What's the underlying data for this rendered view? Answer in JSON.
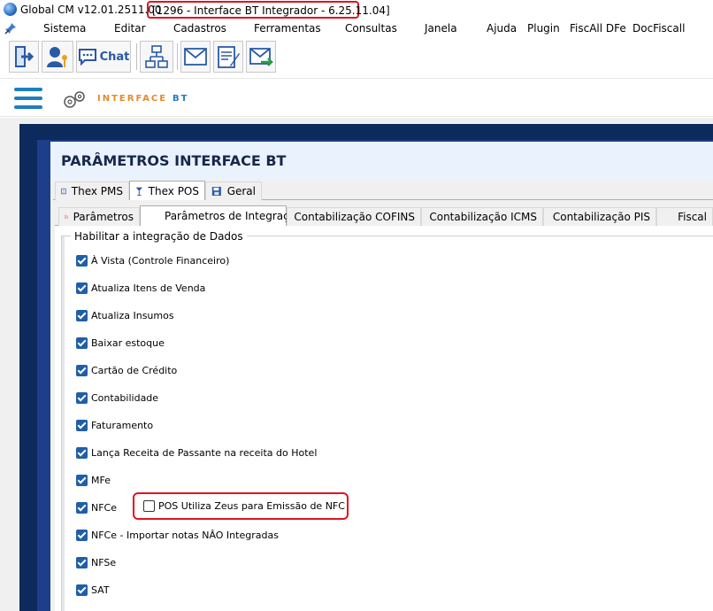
{
  "window": {
    "title": "Global CM v12.01.2511.00",
    "module_title": "[1296 - Interface BT Integrador - 6.25.11.04]"
  },
  "menu": {
    "items": [
      "Sistema",
      "Editar",
      "Cadastros",
      "Ferramentas",
      "Consultas",
      "Janela",
      "Ajuda",
      "Plugin",
      "FiscAll DFe",
      "DocFiscall"
    ]
  },
  "toolbar": {
    "chat_label": "Chat",
    "icons": [
      "exit-icon",
      "user-key-icon",
      "chat-icon",
      "org-chart-icon",
      "mail-icon",
      "document-pen-icon",
      "mail-forward-icon"
    ]
  },
  "header": {
    "brand_main": "INTERFACE",
    "brand_suffix": "BT"
  },
  "panel": {
    "title": "PARÂMETROS INTERFACE BT",
    "tabs": [
      {
        "label": "Thex PMS",
        "icon": "building-icon",
        "active": false
      },
      {
        "label": "Thex POS",
        "icon": "cocktail-icon",
        "active": true
      },
      {
        "label": "Geral",
        "icon": "save-icon",
        "active": false
      }
    ],
    "subtabs": [
      {
        "label": "Parâmetros",
        "active": false
      },
      {
        "label": "Parâmetros de Integração",
        "active": true
      },
      {
        "label": "Contabilização COFINS",
        "active": false
      },
      {
        "label": "Contabilização ICMS",
        "active": false
      },
      {
        "label": "Contabilização PIS",
        "active": false
      },
      {
        "label": "Fiscal",
        "active": false
      }
    ]
  },
  "group": {
    "legend": "Habilitar a integração de Dados",
    "options": [
      {
        "label": "À Vista (Controle Financeiro)",
        "checked": true
      },
      {
        "label": "Atualiza Itens de Venda",
        "checked": true
      },
      {
        "label": "Atualiza Insumos",
        "checked": true
      },
      {
        "label": "Baixar estoque",
        "checked": true
      },
      {
        "label": "Cartão de Crédito",
        "checked": true
      },
      {
        "label": "Contabilidade",
        "checked": true
      },
      {
        "label": "Faturamento",
        "checked": true
      },
      {
        "label": "Lança Receita de Passante na receita do Hotel",
        "checked": true
      },
      {
        "label": "MFe",
        "checked": true
      },
      {
        "label": "NFCe",
        "checked": true
      },
      {
        "label": "NFCe - Importar notas NÂO Integradas",
        "checked": true
      },
      {
        "label": "NFSe",
        "checked": true
      },
      {
        "label": "SAT",
        "checked": true
      }
    ],
    "nfce_suboption": {
      "label": "POS Utiliza Zeus para Emissão de NFC",
      "checked": false
    }
  },
  "colors": {
    "highlight": "#e0141e",
    "checkbox": "#1f5fa8",
    "navy": "#0d2a5c",
    "brand_orange": "#e58a2a",
    "brand_blue": "#1f7fbf"
  }
}
